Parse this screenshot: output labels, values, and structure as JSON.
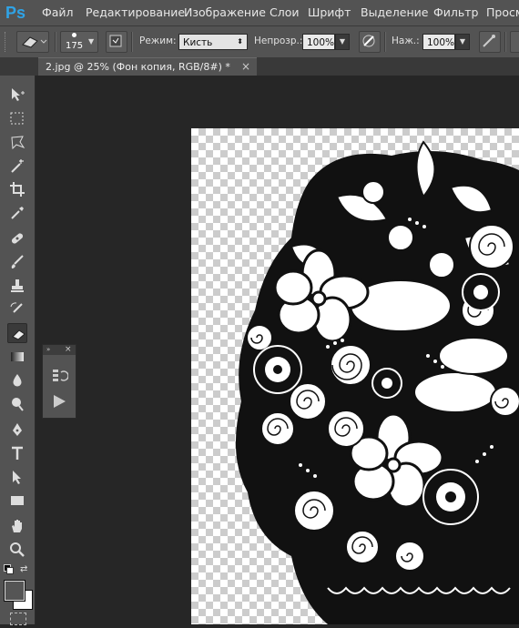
{
  "app": {
    "logo": "Ps"
  },
  "menu": [
    "Файл",
    "Редактирование",
    "Изображение",
    "Слои",
    "Шрифт",
    "Выделение",
    "Фильтр",
    "Просм"
  ],
  "options": {
    "brush_size": "175",
    "mode_label": "Режим:",
    "mode_value": "Кисть",
    "opacity_label": "Непрозр.:",
    "opacity_value": "100%",
    "flow_label": "Наж.:",
    "flow_value": "100%"
  },
  "document_tab": {
    "title": "2.jpg @ 25% (Фон копия, RGB/8#) *",
    "close": "×"
  },
  "toolbar": {
    "collapse": "»",
    "tools": [
      "move-tool",
      "marquee-tool",
      "lasso-tool",
      "magic-wand-tool",
      "crop-tool",
      "eyedropper-tool",
      "healing-brush-tool",
      "brush-tool",
      "clone-stamp-tool",
      "history-brush-tool",
      "eraser-tool",
      "gradient-tool",
      "blur-tool",
      "dodge-tool",
      "pen-tool",
      "type-tool",
      "path-selection-tool",
      "rectangle-tool",
      "hand-tool",
      "zoom-tool"
    ],
    "active_tool": "eraser-tool"
  },
  "panel": {
    "collapse": "»",
    "close": "×"
  },
  "colors": {
    "foreground": "#555555",
    "background": "#ffffff",
    "accent": "#2fa3e6"
  }
}
